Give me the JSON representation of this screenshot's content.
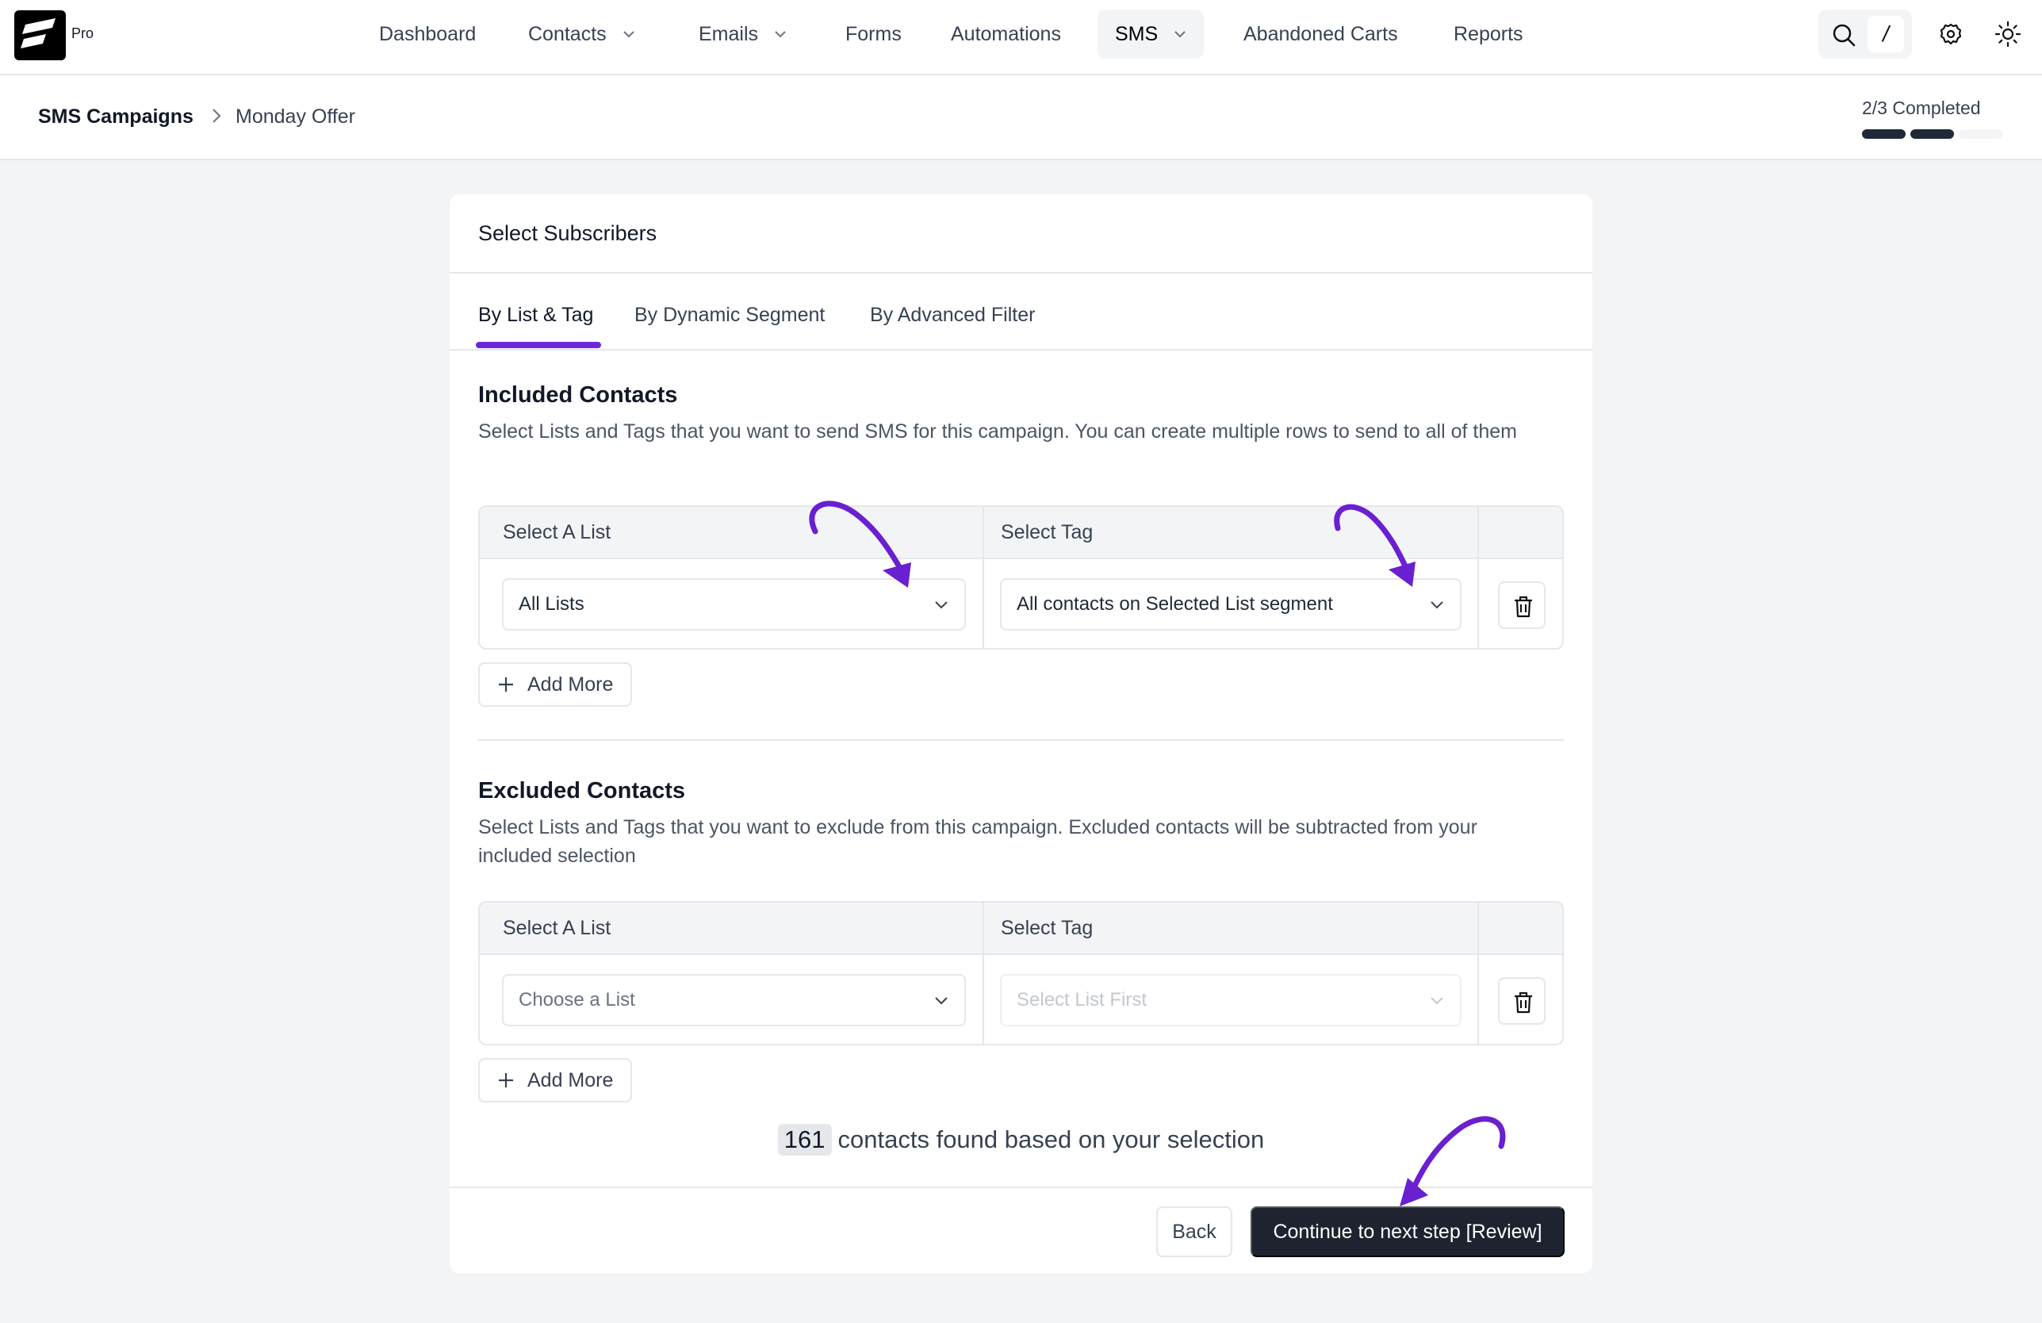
{
  "brand": {
    "badge": "Pro"
  },
  "nav": {
    "items": [
      {
        "label": "Dashboard",
        "dropdown": false,
        "active": false
      },
      {
        "label": "Contacts",
        "dropdown": true,
        "active": false
      },
      {
        "label": "Emails",
        "dropdown": true,
        "active": false
      },
      {
        "label": "Forms",
        "dropdown": false,
        "active": false
      },
      {
        "label": "Automations",
        "dropdown": false,
        "active": false
      },
      {
        "label": "SMS",
        "dropdown": true,
        "active": true
      },
      {
        "label": "Abandoned Carts",
        "dropdown": false,
        "active": false
      },
      {
        "label": "Reports",
        "dropdown": false,
        "active": false
      }
    ],
    "shortcut_key": "/",
    "icons": [
      "search-icon",
      "settings-gear-icon",
      "sun-theme-icon"
    ]
  },
  "breadcrumb": {
    "root": "SMS Campaigns",
    "current": "Monday Offer"
  },
  "progress": {
    "label": "2/3 Completed",
    "completed_steps": 2,
    "total_steps": 3
  },
  "card": {
    "title": "Select Subscribers",
    "tabs": [
      {
        "label": "By List & Tag",
        "active": true
      },
      {
        "label": "By Dynamic Segment",
        "active": false
      },
      {
        "label": "By Advanced Filter",
        "active": false
      }
    ]
  },
  "included": {
    "title": "Included Contacts",
    "description": "Select Lists and Tags that you want to send SMS for this campaign. You can create multiple rows to send to all of them",
    "col_list": "Select A List",
    "col_tag": "Select Tag",
    "list_value": "All Lists",
    "tag_value": "All contacts on Selected List segment",
    "add_more": "Add More"
  },
  "excluded": {
    "title": "Excluded Contacts",
    "description": "Select Lists and Tags that you want to exclude from this campaign. Excluded contacts will be subtracted from your included selection",
    "col_list": "Select A List",
    "col_tag": "Select Tag",
    "list_placeholder": "Choose a List",
    "tag_placeholder": "Select List First",
    "add_more": "Add More"
  },
  "summary": {
    "count": "161",
    "text": "contacts found based on your selection"
  },
  "footer": {
    "back": "Back",
    "next": "Continue to next step [Review]"
  },
  "colors": {
    "accent": "#6d28d9",
    "annotation": "#6a1fd0",
    "primary_button": "#1f2330"
  }
}
